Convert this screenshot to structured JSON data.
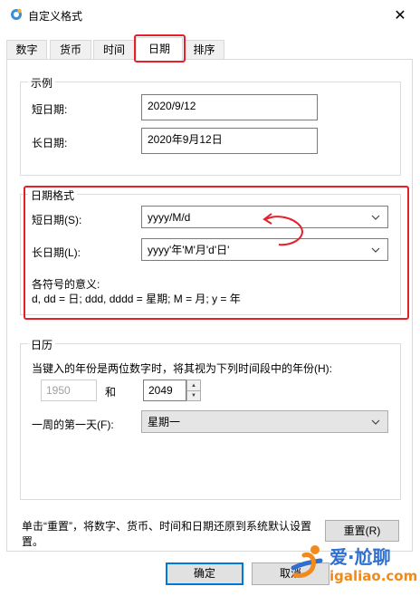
{
  "window": {
    "title": "自定义格式",
    "close_glyph": "✕"
  },
  "tabs": [
    {
      "label": "数字"
    },
    {
      "label": "货币"
    },
    {
      "label": "时间"
    },
    {
      "label": "日期"
    },
    {
      "label": "排序"
    }
  ],
  "examples": {
    "group_title": "示例",
    "short_label": "短日期:",
    "short_value": "2020/9/12",
    "long_label": "长日期:",
    "long_value": "2020年9月12日"
  },
  "date_format": {
    "group_title": "日期格式",
    "short_label": "短日期(S):",
    "short_value": "yyyy/M/d",
    "long_label": "长日期(L):",
    "long_value": "yyyy'年'M'月'd'日'",
    "legend_title": "各符号的意义:",
    "legend_text": "d, dd = 日;  ddd, dddd = 星期;  M = 月;  y = 年"
  },
  "calendar": {
    "group_title": "日历",
    "two_digit_text": "当键入的年份是两位数字时，将其视为下列时间段中的年份(H):",
    "year_from": "1950",
    "and_label": "和",
    "year_to": "2049",
    "first_day_label": "一周的第一天(F):",
    "first_day_value": "星期一"
  },
  "footer": {
    "reset_note_line1": "单击“重置”，将数字、货币、时间和日期还原到系统默认设置",
    "reset_note_line2": "置。",
    "reset_label": "重置(R)",
    "ok_label": "确定",
    "cancel_label": "取消"
  },
  "watermark": {
    "brand": "爱·尬聊",
    "url": "igaliao.com"
  },
  "colors": {
    "highlight": "#e5202a",
    "accent": "#0078d7"
  }
}
